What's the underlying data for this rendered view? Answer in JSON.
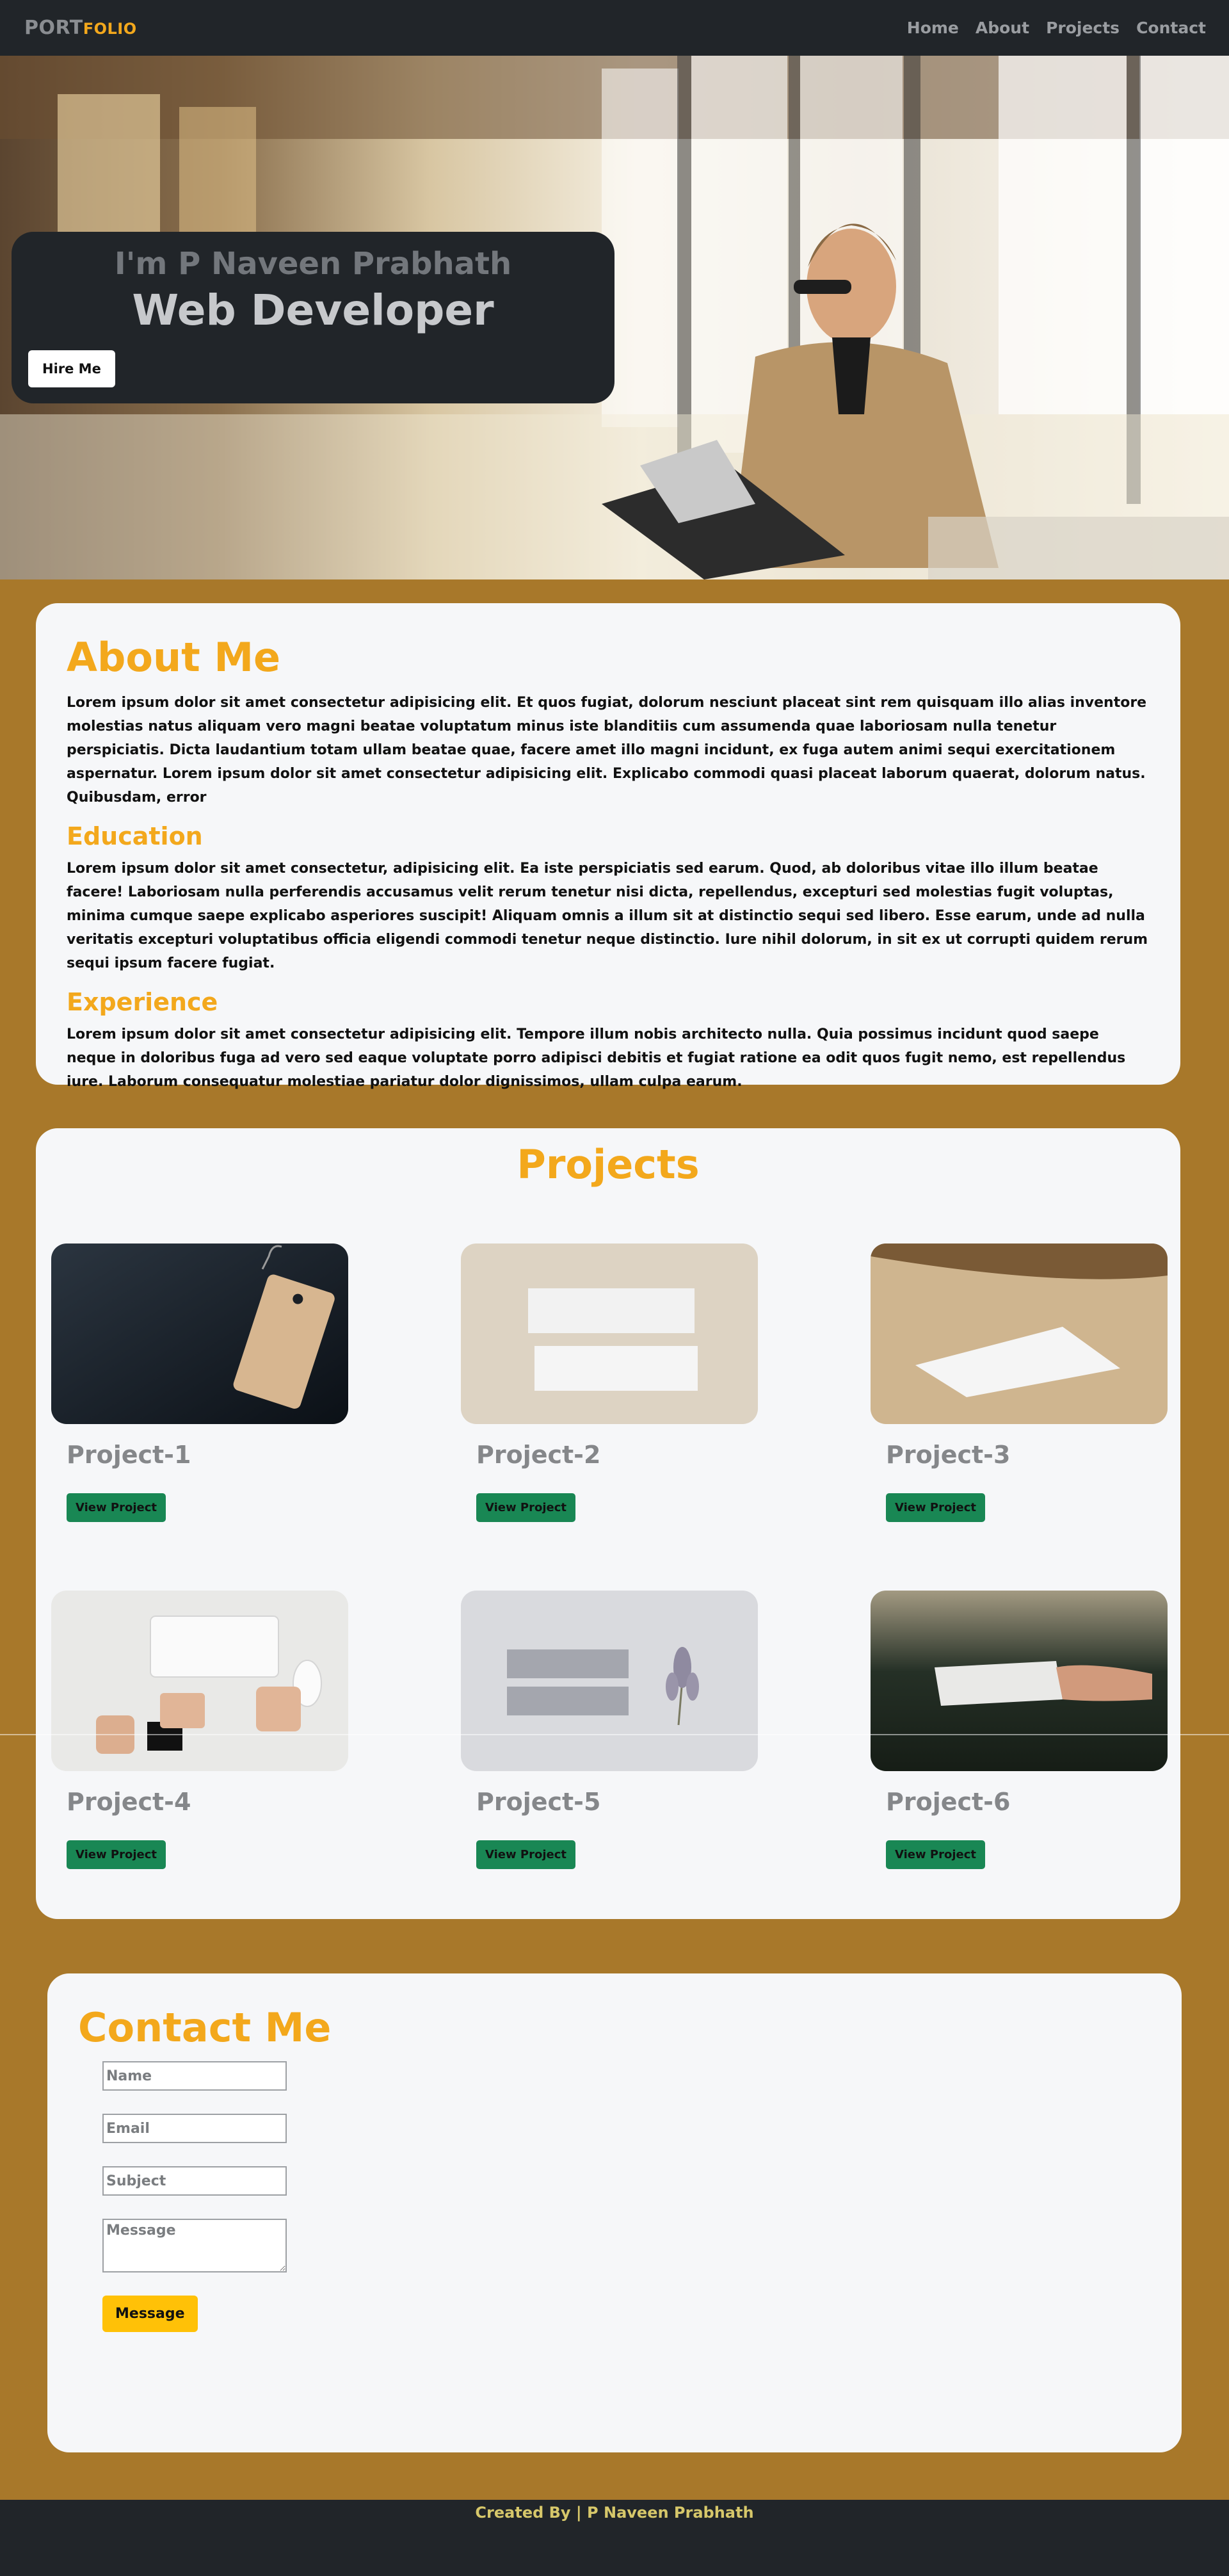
{
  "navbar": {
    "brand_part1": "PORT",
    "brand_part2": "FOLIO",
    "links": [
      "Home",
      "About",
      "Projects",
      "Contact"
    ]
  },
  "hero": {
    "intro": "I'm P Naveen Prabhath",
    "role": "Web Developer",
    "button": "Hire Me"
  },
  "about": {
    "title": "About Me",
    "text": "Lorem ipsum dolor sit amet consectetur adipisicing elit. Et quos fugiat, dolorum nesciunt placeat sint rem quisquam illo alias inventore molestias natus aliquam vero magni beatae voluptatum minus iste blanditiis cum assumenda quae laboriosam nulla tenetur perspiciatis. Dicta laudantium totam ullam beatae quae, facere amet illo magni incidunt, ex fuga autem animi sequi exercitationem aspernatur. Lorem ipsum dolor sit amet consectetur adipisicing elit. Explicabo commodi quasi placeat laborum quaerat, dolorum natus. Quibusdam, error",
    "education_title": "Education",
    "education_text": "Lorem ipsum dolor sit amet consectetur, adipisicing elit. Ea iste perspiciatis sed earum. Quod, ab doloribus vitae illo illum beatae facere! Laboriosam nulla perferendis accusamus velit rerum tenetur nisi dicta, repellendus, excepturi sed molestias fugit voluptas, minima cumque saepe explicabo asperiores suscipit! Aliquam omnis a illum sit at distinctio sequi sed libero. Esse earum, unde ad nulla veritatis excepturi voluptatibus officia eligendi commodi tenetur neque distinctio. Iure nihil dolorum, in sit ex ut corrupti quidem rerum sequi ipsum facere fugiat.",
    "experience_title": "Experience",
    "experience_text": "Lorem ipsum dolor sit amet consectetur adipisicing elit. Tempore illum nobis architecto nulla. Quia possimus incidunt quod saepe neque in doloribus fuga ad vero sed eaque voluptate porro adipisci debitis et fugiat ratione ea odit quos fugit nemo, est repellendus iure. Laborum consequatur molestiae pariatur dolor dignissimos, ullam culpa earum."
  },
  "projects": {
    "title": "Projects",
    "items": [
      {
        "title": "Project-1",
        "button": "View Project"
      },
      {
        "title": "Project-2",
        "button": "View Project"
      },
      {
        "title": "Project-3",
        "button": "View Project"
      },
      {
        "title": "Project-4",
        "button": "View Project"
      },
      {
        "title": "Project-5",
        "button": "View Project"
      },
      {
        "title": "Project-6",
        "button": "View Project"
      }
    ]
  },
  "contact": {
    "title": "Contact Me",
    "name_placeholder": "Name",
    "email_placeholder": "Email",
    "subject_placeholder": "Subject",
    "message_placeholder": "Message",
    "button": "Message"
  },
  "footer": {
    "text": "Created By | P Naveen Prabhath"
  },
  "colors": {
    "page_bg": "#a8782a",
    "navbar": "#212529",
    "accent": "#f3a81c",
    "card_bg": "#f6f7f9",
    "project_button": "#198754",
    "submit_button": "#ffc107"
  }
}
